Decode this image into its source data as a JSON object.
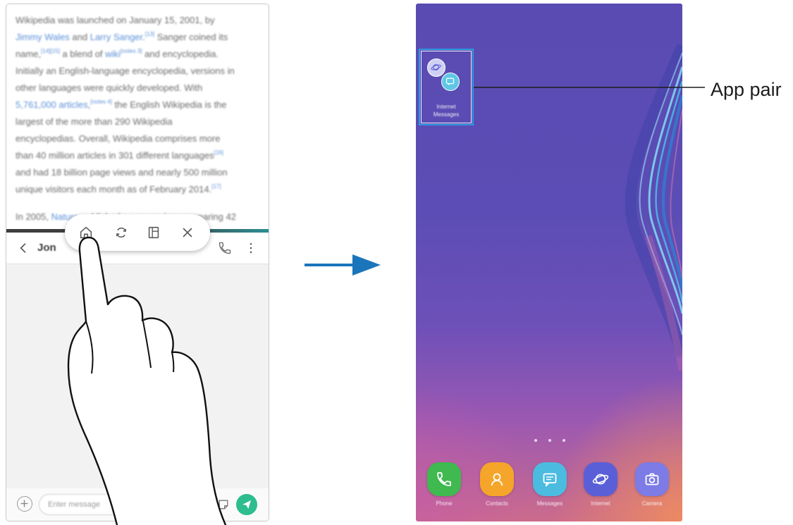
{
  "left_phone": {
    "article": {
      "lines": [
        [
          {
            "text": "Wikipedia was launched on January 15, 2001, by"
          }
        ],
        [
          {
            "link": "Jimmy Wales"
          },
          {
            "text": " and "
          },
          {
            "link": "Larry Sanger"
          },
          {
            "text": "."
          },
          {
            "sup": "[13]"
          },
          {
            "text": " Sanger coined its"
          }
        ],
        [
          {
            "text": "name,"
          },
          {
            "sup": "[14][15]"
          },
          {
            "text": " a blend of "
          },
          {
            "link": "wiki"
          },
          {
            "sup": "[notes 3]"
          },
          {
            "text": " and encyclopedia."
          }
        ],
        [
          {
            "text": "Initially an English-language encyclopedia, versions in"
          }
        ],
        [
          {
            "text": "other languages were quickly developed. With"
          }
        ],
        [
          {
            "link": "5,761,000 articles"
          },
          {
            "text": ","
          },
          {
            "sup": "[notes 4]"
          },
          {
            "text": " the English Wikipedia is the"
          }
        ],
        [
          {
            "text": "largest of the more than 290 Wikipedia"
          }
        ],
        [
          {
            "text": "encyclopedias. Overall, Wikipedia comprises more"
          }
        ],
        [
          {
            "text": "than 40 million articles in 301 different languages"
          },
          {
            "sup": "[16]"
          }
        ],
        [
          {
            "text": "and had 18 billion page views and nearly 500 million"
          }
        ],
        [
          {
            "text": "unique visitors each month as of February 2014."
          },
          {
            "sup": "[17]"
          }
        ],
        [
          {
            "text": "In 2005, "
          },
          {
            "link": "Nature"
          },
          {
            "text": " published a peer review comparing 42"
          }
        ]
      ]
    },
    "toolbar": {
      "icons": [
        "home-icon",
        "rotate-icon",
        "split-view-icon",
        "close-icon"
      ]
    },
    "chat": {
      "contact_name": "Jon",
      "input_placeholder": "Enter message",
      "icons": [
        "chevron-left-icon",
        "call-icon",
        "more-vertical-icon",
        "plus-icon",
        "sticker-icon",
        "send-icon"
      ]
    }
  },
  "right_phone": {
    "app_pair": {
      "label_lines": [
        "Internet",
        "Messages"
      ],
      "icons": [
        "internet-icon",
        "messages-icon"
      ]
    },
    "callout_label": "App pair",
    "page_indicator": {
      "pages": 3
    },
    "dock": [
      {
        "label": "Phone",
        "icon": "phone-icon",
        "color": "#3fb950"
      },
      {
        "label": "Contacts",
        "icon": "contacts-icon",
        "color": "#f5a52a"
      },
      {
        "label": "Messages",
        "icon": "messages-icon",
        "color": "#4cbbe0"
      },
      {
        "label": "Internet",
        "icon": "internet-icon",
        "color": "#5a5fd8"
      },
      {
        "label": "Camera",
        "icon": "camera-icon",
        "color": "#7d7be6"
      }
    ]
  },
  "colors": {
    "highlight_outline": "#2f9ae0",
    "arrow": "#1b75bb",
    "link": "#5b8fd8",
    "send_button": "#2dbd8e",
    "wallpaper_top": "#5a4bb2",
    "wallpaper_bottom": "#d86f78"
  }
}
